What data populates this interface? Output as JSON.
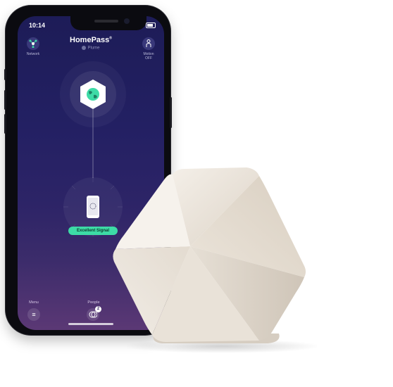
{
  "status_bar": {
    "time": "10:14"
  },
  "app": {
    "title": "HomePass",
    "subtitle": "Plume"
  },
  "header": {
    "left": {
      "label": "Network",
      "icon": "network-icon"
    },
    "right": {
      "label_line1": "Motion",
      "label_line2": "OFF",
      "icon": "motion-person-icon"
    }
  },
  "network": {
    "gateway_icon": "globe-icon",
    "device_icon": "smartphone-icon",
    "signal_label": "Excellent Signal"
  },
  "bottom_bar": {
    "menu": {
      "label": "Menu",
      "icon": "hamburger-icon"
    },
    "people": {
      "label": "People",
      "icon": "people-icon",
      "badge": "2"
    }
  },
  "colors": {
    "screen_top": "#1d1c57",
    "screen_bottom": "#5b3875",
    "signal_green": "#3ddba6",
    "pod_light": "#efe9e1",
    "pod_shadow": "#cfc5b8"
  }
}
